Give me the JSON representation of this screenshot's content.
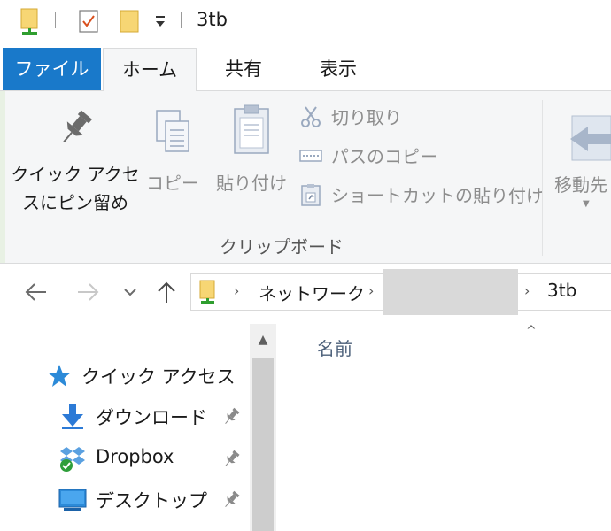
{
  "window": {
    "title": "3tb"
  },
  "ribbon_tabs": {
    "file": "ファイル",
    "home": "ホーム",
    "share": "共有",
    "view": "表示"
  },
  "clipboard": {
    "pin_label_line1": "クイック アクセ",
    "pin_label_line2": "スにピン留め",
    "copy": "コピー",
    "paste": "貼り付け",
    "cut": "切り取り",
    "copy_path": "パスのコピー",
    "paste_shortcut": "ショートカットの貼り付け",
    "group_label": "クリップボード"
  },
  "organize": {
    "move_to": "移動先"
  },
  "address_bar": {
    "segments": [
      "ネットワーク",
      "3tb"
    ]
  },
  "nav_pane": {
    "quick_access": "クイック アクセス",
    "items": [
      {
        "label": "ダウンロード",
        "icon": "download-icon",
        "pinned": true
      },
      {
        "label": "Dropbox",
        "icon": "dropbox-icon",
        "pinned": true
      },
      {
        "label": "デスクトップ",
        "icon": "desktop-icon",
        "pinned": true
      }
    ]
  },
  "file_list": {
    "column_name": "名前"
  },
  "colors": {
    "file_tab": "#1979ca",
    "ribbon_bg": "#f5f6f7",
    "disabled_text": "#8d8d8d",
    "header_text": "#4c607a"
  }
}
